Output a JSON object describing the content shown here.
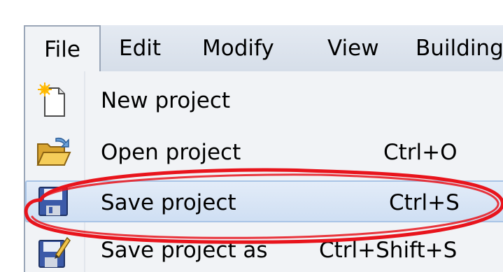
{
  "menubar": {
    "items": [
      {
        "label": "File"
      },
      {
        "label": "Edit"
      },
      {
        "label": "Modify"
      },
      {
        "label": "View"
      },
      {
        "label": "Building"
      }
    ]
  },
  "file_menu": {
    "items": [
      {
        "label": "New project",
        "shortcut": "",
        "icon": "new-document-icon"
      },
      {
        "label": "Open project",
        "shortcut": "Ctrl+O",
        "icon": "open-folder-icon"
      },
      {
        "label": "Save project",
        "shortcut": "Ctrl+S",
        "icon": "floppy-disk-icon",
        "highlighted": true
      },
      {
        "label": "Save project as",
        "shortcut": "Ctrl+Shift+S",
        "icon": "save-as-icon"
      }
    ]
  },
  "annotation": {
    "color": "#e8141c",
    "shape": "ellipse around Save project"
  },
  "colors": {
    "menubar_bg": "#dde4ee",
    "menu_bg": "#f1f3f6",
    "highlight_bg": "#d8e6f6",
    "highlight_border": "#a8c4e6"
  }
}
